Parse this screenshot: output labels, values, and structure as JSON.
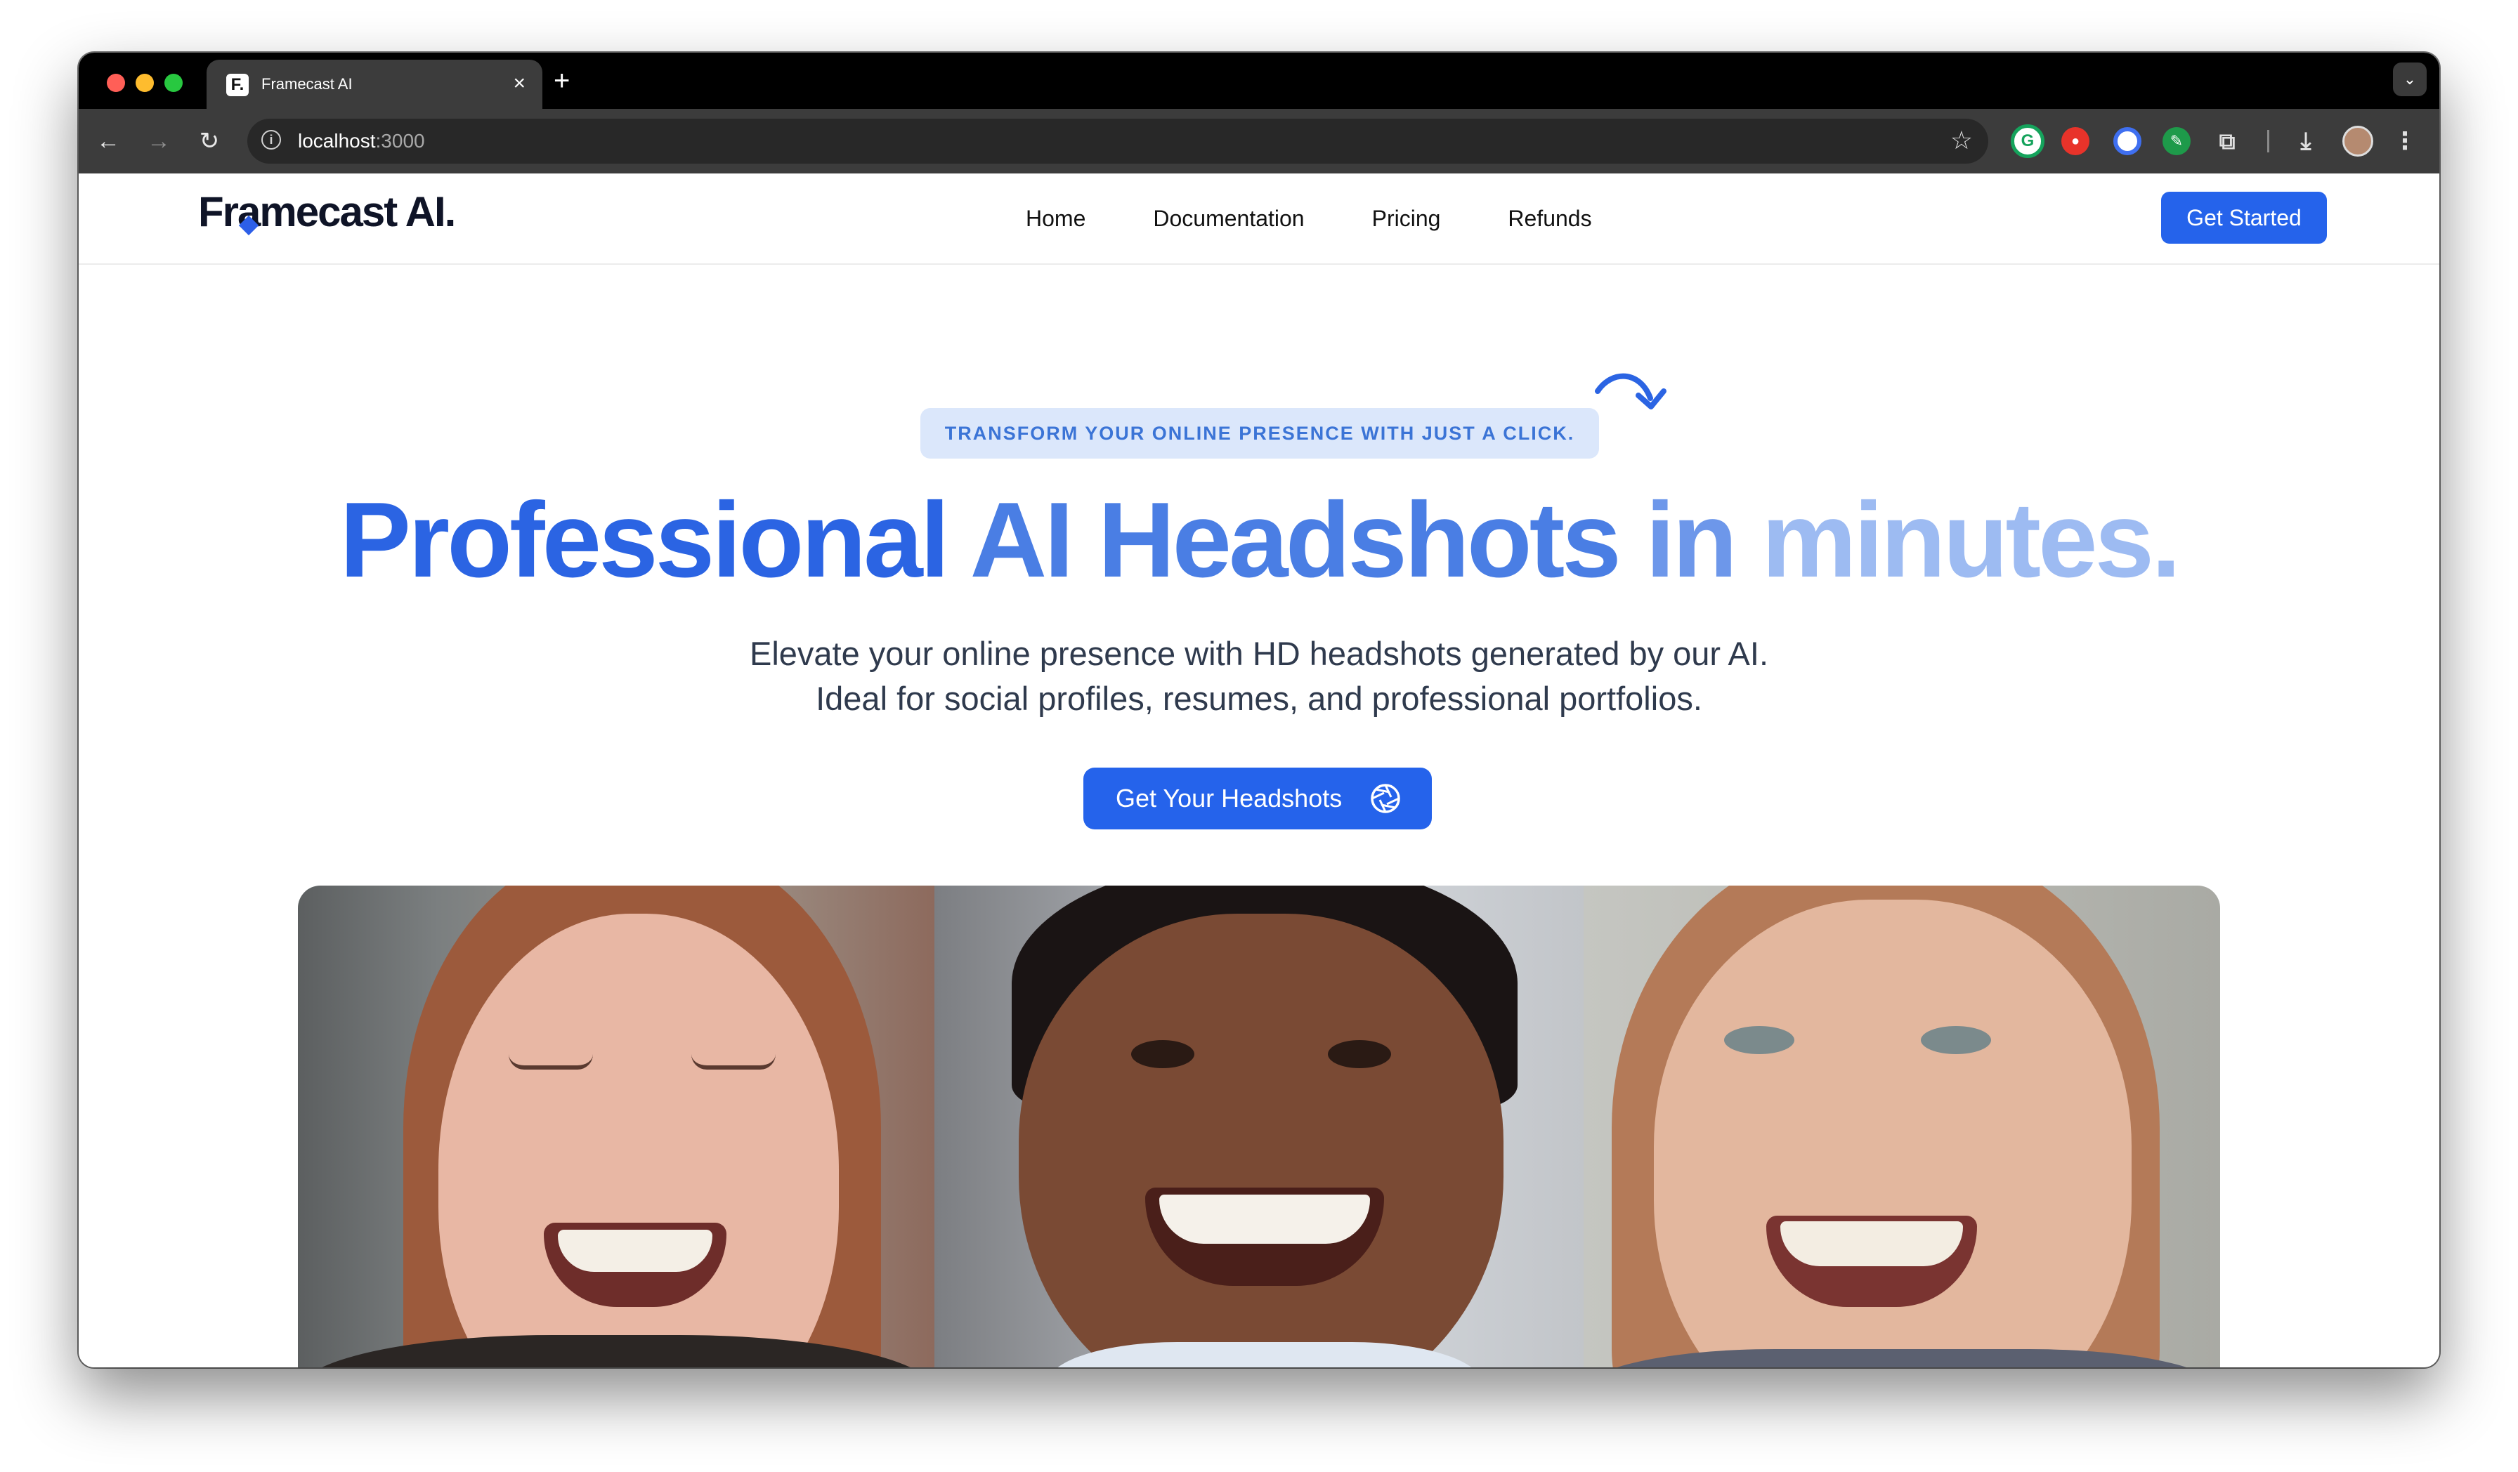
{
  "browser": {
    "tab": {
      "title": "Framecast AI",
      "favicon": "F."
    },
    "new_tab_icon": "plus-icon",
    "url": {
      "host": "localhost",
      "port": ":3000"
    }
  },
  "site": {
    "logo": "Framecast AI.",
    "nav": [
      "Home",
      "Documentation",
      "Pricing",
      "Refunds"
    ],
    "cta": "Get Started"
  },
  "hero": {
    "badge": "TRANSFORM YOUR ONLINE PRESENCE WITH JUST A CLICK.",
    "title": {
      "part1": "Professional ",
      "part2": "AI Headshots ",
      "part3": "in ",
      "part4": "minutes."
    },
    "subtitle_line1": "Elevate your online presence with HD headshots generated by our AI.",
    "subtitle_line2": "Ideal for social profiles, resumes, and professional portfolios.",
    "button": "Get Your Headshots"
  },
  "colors": {
    "accent": "#2563eb",
    "badge_bg": "#dbe7fb",
    "badge_text": "#3b74d6"
  }
}
